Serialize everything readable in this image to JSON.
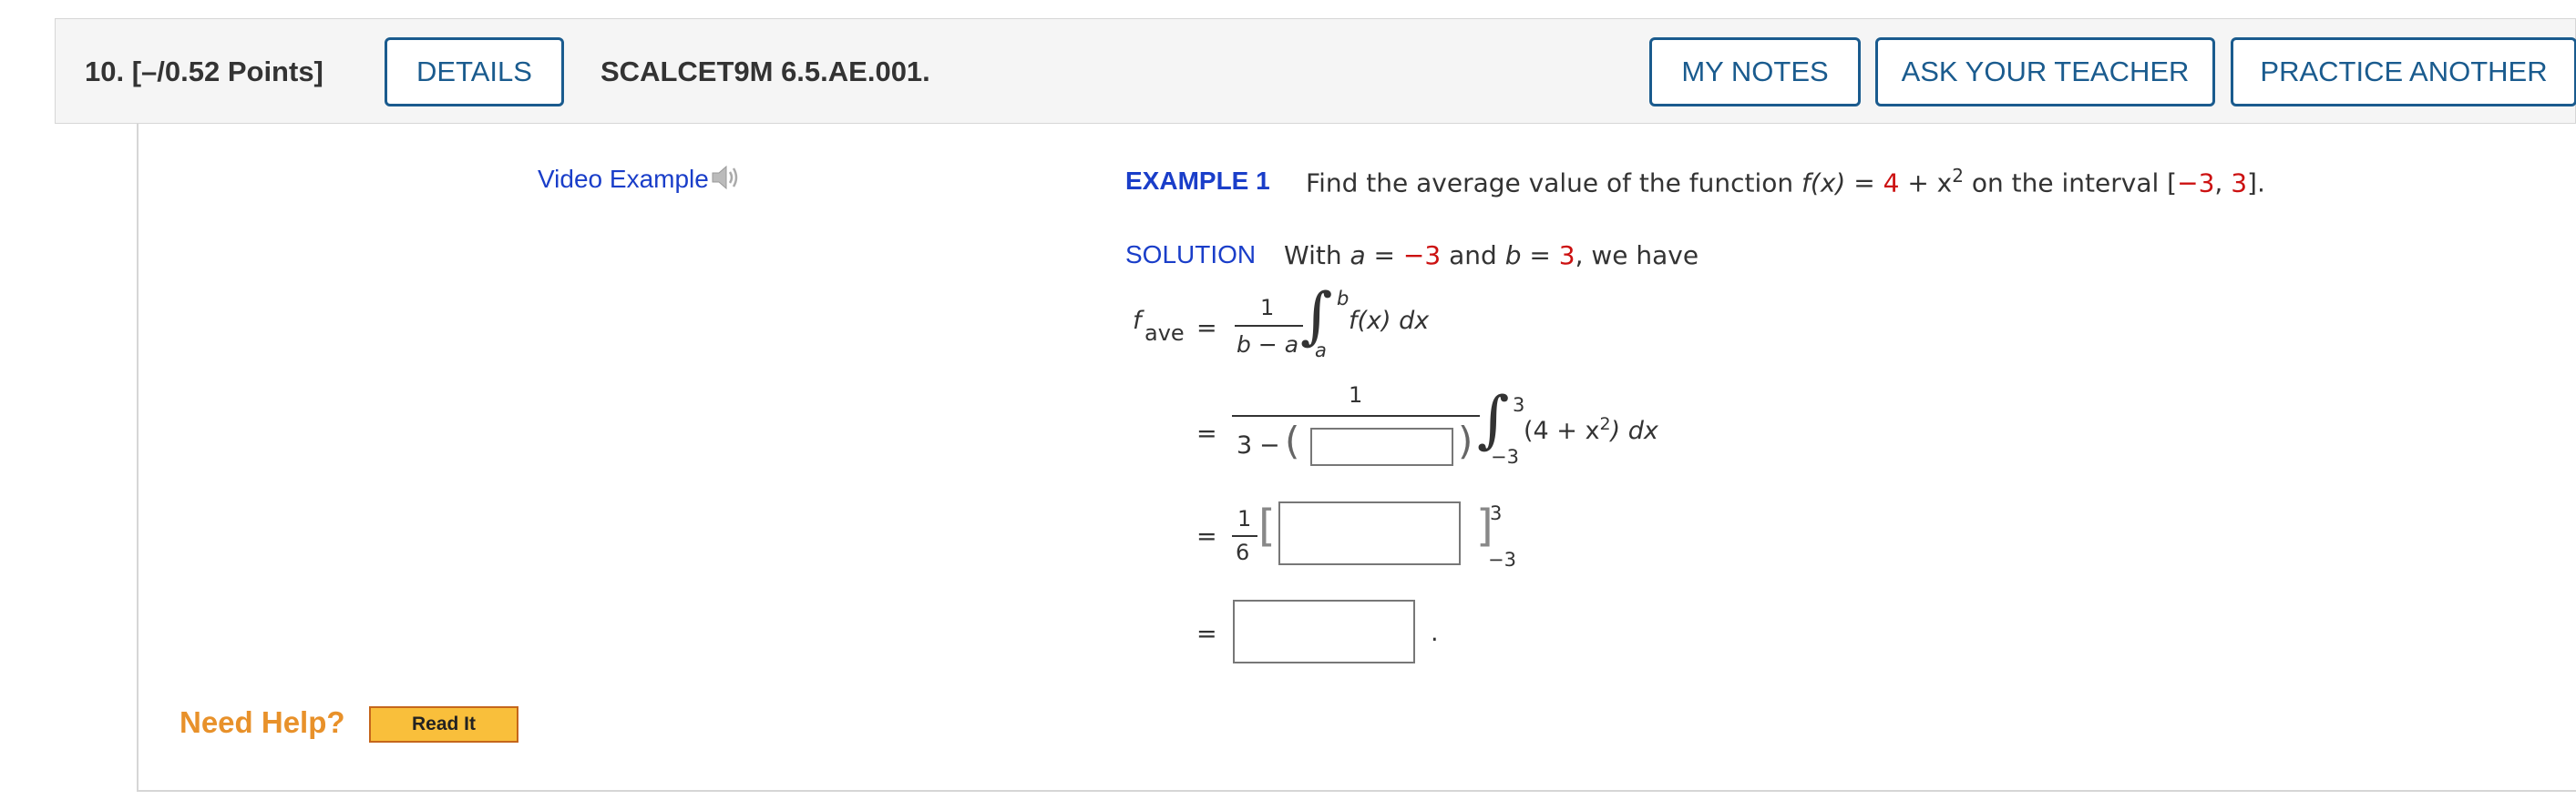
{
  "header": {
    "question_label": "10.  [–/0.52 Points]",
    "details_label": "DETAILS",
    "code": "SCALCET9M 6.5.AE.001.",
    "my_notes_label": "MY NOTES",
    "ask_teacher_label": "ASK YOUR TEACHER",
    "practice_label": "PRACTICE ANOTHER"
  },
  "video": {
    "label": "Video Example"
  },
  "example": {
    "label": "EXAMPLE 1",
    "text_pre": "Find the average value of the function ",
    "fx": "f(x)",
    "eq": " = ",
    "four": "4",
    "plus_x": " + x",
    "exp2": "2",
    "text_mid": " on the interval [",
    "a": "−3",
    "comma": ", ",
    "b": "3",
    "text_end": "]."
  },
  "solution": {
    "label": "SOLUTION",
    "with": "With ",
    "a_var": "a",
    "eq1": " = ",
    "a_val": "−3",
    "and": " and ",
    "b_var": "b",
    "eq2": " = ",
    "b_val": "3",
    "rest": ", we have"
  },
  "math": {
    "f": "f",
    "ave": "ave",
    "equals": "=",
    "one": "1",
    "b_minus_a": "b − a",
    "upper_b": "b",
    "lower_a": "a",
    "integrand1": "f(x) dx",
    "three": "3",
    "minus": "−",
    "upper_3": "3",
    "lower_neg3": "−3",
    "integrand2_pre": "(4 + x",
    "integrand2_exp": "2",
    "integrand2_post": ") dx",
    "six": "6",
    "period": "."
  },
  "inputs": {
    "box1": "",
    "box2": "",
    "box3": ""
  },
  "help": {
    "need_help": "Need Help?",
    "read_it": "Read It"
  },
  "colors": {
    "accent_blue": "#1a5b8e",
    "link_blue": "#1a3ec9",
    "red": "#cc1111",
    "help_orange": "#e8912a"
  }
}
